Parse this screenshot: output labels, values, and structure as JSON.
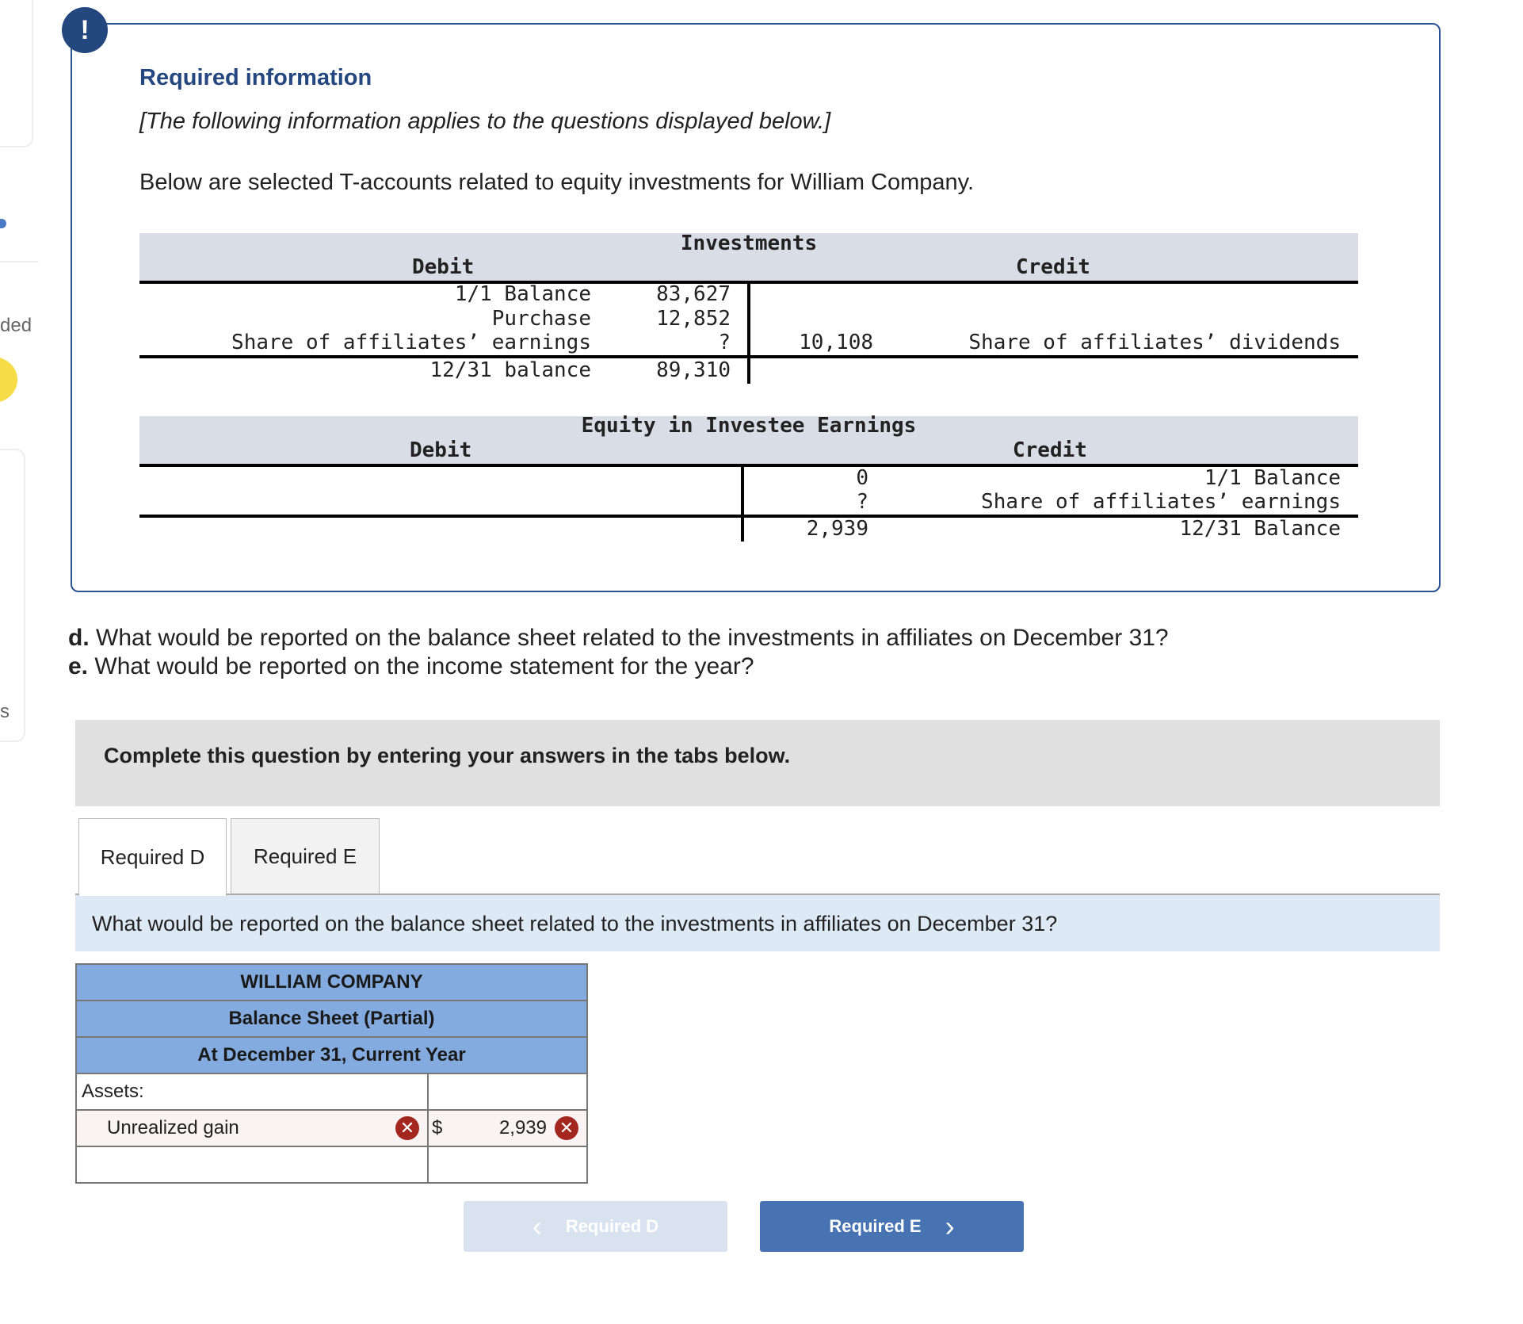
{
  "sidebar": {
    "partial_text_1": "ded",
    "partial_text_2": "s"
  },
  "alert": {
    "icon": "exclamation-icon",
    "icon_glyph": "!",
    "title": "Required information",
    "subtitle": "[The following information applies to the questions displayed below.]",
    "intro": "Below are selected T-accounts related to equity investments for William Company."
  },
  "investments": {
    "title": "Investments",
    "debit_label": "Debit",
    "credit_label": "Credit",
    "debit_rows": [
      {
        "label": "1/1 Balance",
        "value": "83,627"
      },
      {
        "label": "Purchase",
        "value": "12,852"
      },
      {
        "label": "Share of affiliates’ earnings",
        "value": "?"
      }
    ],
    "credit_rows": [
      {
        "label": "Share of affiliates’ dividends",
        "value": "10,108"
      }
    ],
    "ending": {
      "label": "12/31 balance",
      "value": "89,310"
    }
  },
  "equity": {
    "title": "Equity in Investee Earnings",
    "debit_label": "Debit",
    "credit_label": "Credit",
    "credit_rows": [
      {
        "label": "1/1 Balance",
        "value": "0"
      },
      {
        "label": "Share of affiliates’ earnings",
        "value": "?"
      }
    ],
    "ending": {
      "label": "12/31 Balance",
      "value": "2,939"
    }
  },
  "questions": [
    {
      "letter": "d.",
      "text": "What would be reported on the balance sheet related to the investments in affiliates on December 31?"
    },
    {
      "letter": "e.",
      "text": "What would be reported on the income statement for the year?"
    }
  ],
  "instruction": "Complete this question by entering your answers in the tabs below.",
  "tabs": [
    {
      "label": "Required D",
      "active": true
    },
    {
      "label": "Required E",
      "active": false
    }
  ],
  "prompt": "What would be reported on the balance sheet related to the investments in affiliates on December 31?",
  "balance_sheet": {
    "company": "WILLIAM COMPANY",
    "title": "Balance Sheet (Partial)",
    "date": "At December 31, Current Year",
    "section": "Assets:",
    "row_label": "Unrealized gain",
    "currency": "$",
    "row_value": "2,939",
    "incorrect_icon": "x-circle-icon",
    "x_glyph": "✕"
  },
  "nav": {
    "prev_label": "Required D",
    "next_label": "Required E",
    "prev_glyph": "‹",
    "next_glyph": "›"
  },
  "colors": {
    "accent": "#24477f",
    "header_blue": "#84abdf",
    "button_blue": "#4773b3",
    "error_red": "#a3261f"
  }
}
